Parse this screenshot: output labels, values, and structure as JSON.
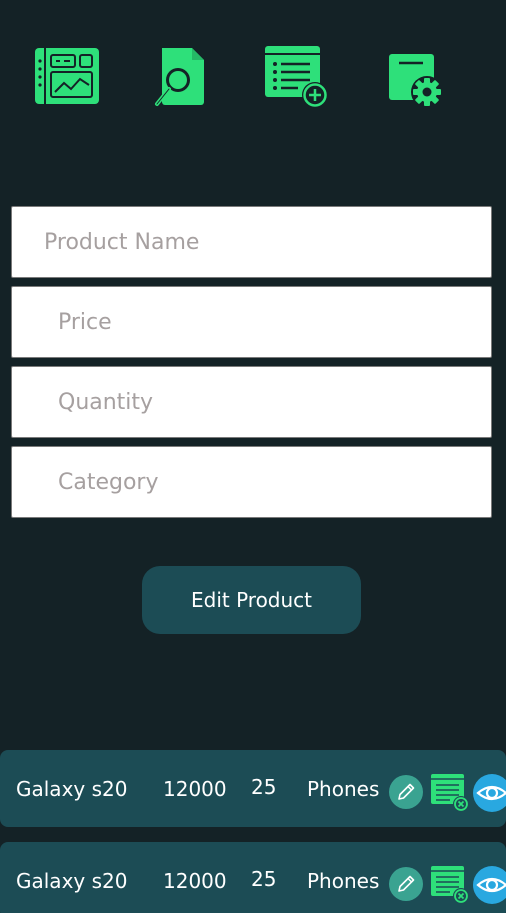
{
  "nav": {
    "items": [
      {
        "name": "dashboard",
        "icon": "dashboard-icon"
      },
      {
        "name": "search-product",
        "icon": "document-search-icon"
      },
      {
        "name": "add-product",
        "icon": "list-add-icon"
      },
      {
        "name": "product-settings",
        "icon": "folder-settings-icon"
      }
    ]
  },
  "form": {
    "product_name_placeholder": "Product Name",
    "price_placeholder": "Price",
    "quantity_placeholder": "Quantity",
    "category_placeholder": "Category",
    "submit_label": "Edit Product"
  },
  "products": [
    {
      "name": "Galaxy s20",
      "price": "12000",
      "quantity": "25",
      "category": "Phones"
    },
    {
      "name": "Galaxy s20",
      "price": "12000",
      "quantity": "25",
      "category": "Phones"
    }
  ],
  "colors": {
    "background": "#142226",
    "accent_green": "#2ee07a",
    "row_bg": "#1c4c55",
    "edit_icon_bg": "#3aa391",
    "view_icon_bg": "#29a8e0"
  }
}
